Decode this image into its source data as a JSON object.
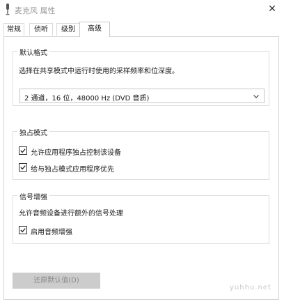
{
  "window": {
    "title": "麦克风 属性",
    "icon": "microphone-icon",
    "close_glyph": "✕"
  },
  "tabs": [
    {
      "label": "常规",
      "active": false
    },
    {
      "label": "侦听",
      "active": false
    },
    {
      "label": "级别",
      "active": false
    },
    {
      "label": "高级",
      "active": true
    }
  ],
  "default_format": {
    "title": "默认格式",
    "description": "选择在共享模式中运行时使用的采样频率和位深度。",
    "selected": "2 通道，16 位，48000 Hz (DVD 音质)"
  },
  "exclusive_mode": {
    "title": "独占模式",
    "options": [
      {
        "label": "允许应用程序独占控制该设备",
        "checked": true
      },
      {
        "label": "给与独占模式应用程序优先",
        "checked": true
      }
    ]
  },
  "signal_enhancement": {
    "title": "信号增强",
    "description": "允许音频设备进行额外的信号处理",
    "options": [
      {
        "label": "启用音频增强",
        "checked": true
      }
    ]
  },
  "buttons": {
    "restore_defaults": "还原默认值(D)"
  },
  "watermark": "yuhhu.net",
  "colors": {
    "panel_border": "#d4d4d4",
    "disabled_button_bg": "#cccccc",
    "disabled_text": "#8a8a8a"
  }
}
